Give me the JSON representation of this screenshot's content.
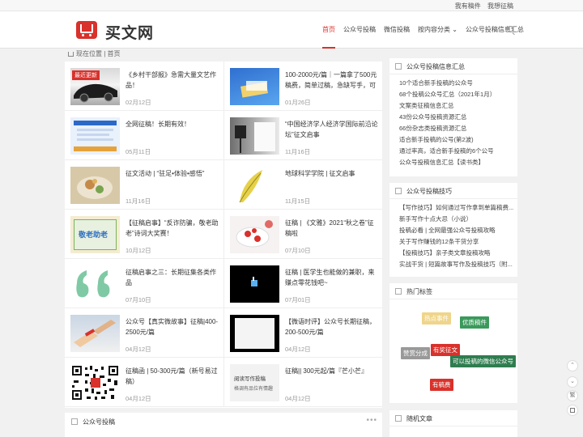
{
  "topbar": {
    "link1": "我有稿件",
    "link2": "我想征稿"
  },
  "logo": {
    "text": "买文网"
  },
  "nav": {
    "items": [
      "首页",
      "公众号投稿",
      "微信投稿",
      "按内容分类",
      "公众号投稿信息汇总"
    ]
  },
  "breadcrumb": {
    "label": "现在位置",
    "sep": "|",
    "current": "首页"
  },
  "posts": [
    {
      "title": "《乡村干部报》急需大量文艺作品！",
      "date": "02月12日",
      "thumb_label": "最近更新"
    },
    {
      "title": "100-2000元/篇｜一篇拿了500元稿费，简单过稿，急缺写手，可",
      "date": "01月26日"
    },
    {
      "title": "全网征稿！长期有效！",
      "date": "05月11日"
    },
    {
      "title": "“中国经济学人经济学国际前沿论坛”征文启事",
      "date": "11月16日"
    },
    {
      "title": "征文活动 | “驻足•体验•感悟”",
      "date": "11月16日"
    },
    {
      "title": "地球科学学院 | 征文启事",
      "date": "11月15日"
    },
    {
      "title": "【征稿启事】“反诈防骗，敬老助老”诗词大奖赛！",
      "date": "10月12日",
      "thumb_label": "敬老助老"
    },
    {
      "title": "征稿 | 《文雅》2021“秋之卷”征稿啦",
      "date": "07月10日"
    },
    {
      "title": "征稿启事之三：长期征集各类作品",
      "date": "07月10日"
    },
    {
      "title": "征稿 | 医学生也能做的兼职，来赚点零花钱吧~",
      "date": "07月01日"
    },
    {
      "title": "公众号【真实微故事】征稿|400-2500元/篇",
      "date": "04月12日"
    },
    {
      "title": "【微语时评】公众号长期征稿，200-500元/篇",
      "date": "04月12日"
    },
    {
      "title": "征稿函 | 50-300元/篇（新号易过稿）",
      "date": "04月12日"
    },
    {
      "title": "征稿|| 300元起/篇『芒小芒』",
      "date": "04月12日",
      "thumb_label": "阅读写作投稿",
      "thumb_sub": "格调有品位有情趣"
    }
  ],
  "section_bottom": {
    "title": "公众号投稿",
    "more": "•••"
  },
  "widget1": {
    "title": "公众号投稿信息汇总",
    "items": [
      "10个适合新手投稿的公众号",
      "68个投稿公众号汇总（2021年1月）",
      "文案类征稿信息汇总",
      "43份公众号投稿资源汇总",
      "66份杂志类投稿资源汇总",
      "适合新手投稿的公号(第2波)",
      "通过率高，适合新手投稿的6个公号",
      "公众号投稿信息汇总【读书类】"
    ]
  },
  "widget2": {
    "title": "公众号投稿技巧",
    "items": [
      "【写作技巧】如何通过写作拿到单篇稿费...",
      "新手写作十点大忌（小说）",
      "投稿必看 | 全网最强公众号投稿攻略",
      "关于写作赚钱的12条干货分享",
      "【投稿技巧】亲子类文章投稿攻略",
      "实战干货 | 短篇故事写作及投稿技巧（附..."
    ]
  },
  "widget3": {
    "title": "热门标签",
    "tags": [
      {
        "text": "热点事件",
        "color": "#e8c97a"
      },
      {
        "text": "优质稿件",
        "color": "#3a9a5b"
      },
      {
        "text": "赞赏分成",
        "color": "#999999"
      },
      {
        "text": "有奖征文",
        "color": "#d9312b"
      },
      {
        "text": "可以投稿的微信公众号",
        "color": "#2f7d4f"
      },
      {
        "text": "有稿费",
        "color": "#d9312b"
      }
    ]
  },
  "widget4": {
    "title": "随机文章"
  },
  "float": {
    "top": "⌃",
    "down": "⌄",
    "trad": "繁"
  }
}
